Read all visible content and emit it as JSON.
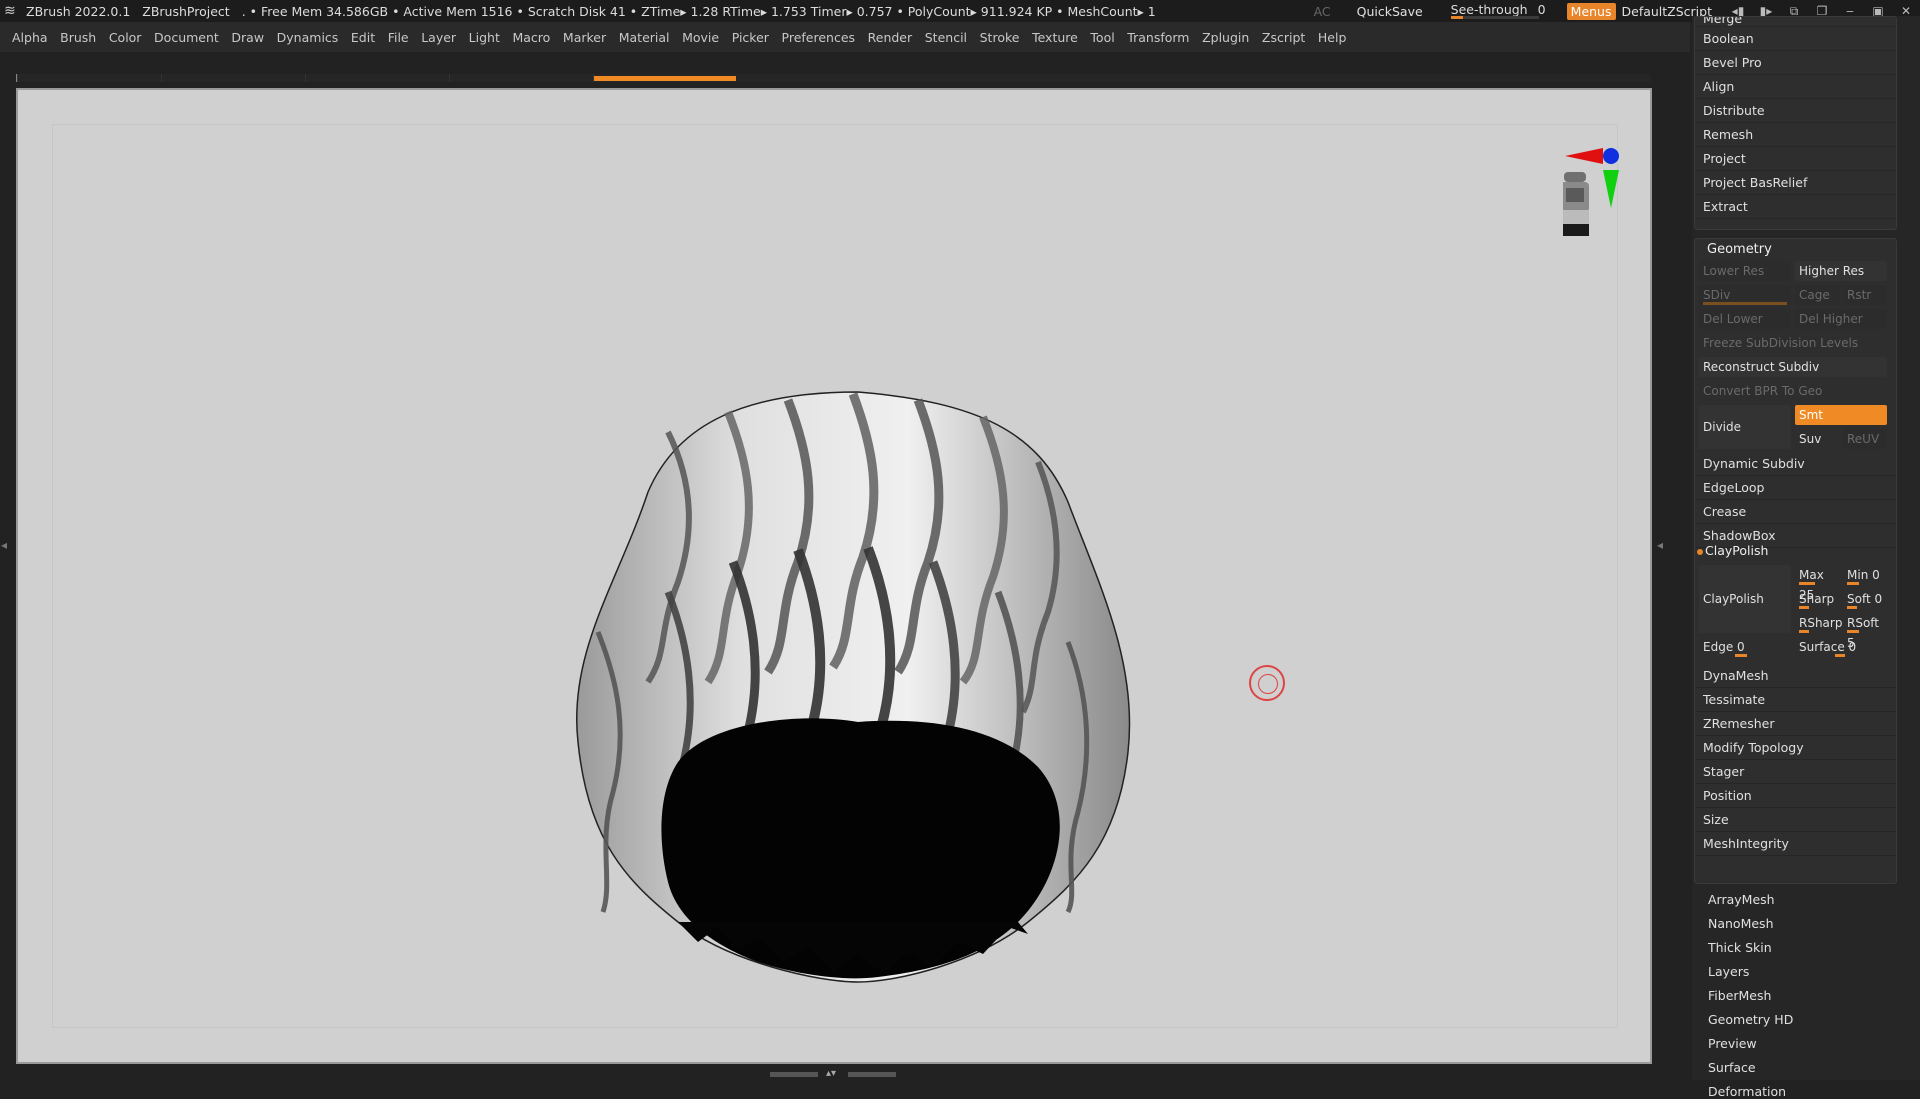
{
  "titlebar": {
    "app": "ZBrush 2022.0.1",
    "project": "ZBrushProject",
    "stats": ". • Free Mem 34.586GB • Active Mem 1516 • Scratch Disk 41 •  ZTime▸ 1.28 RTime▸ 1.753 Timer▸ 0.757 • PolyCount▸ 911.924 KP  • MeshCount▸ 1",
    "ac": "AC",
    "quicksave": "QuickSave",
    "see_through_label": "See-through",
    "see_through_value": "0",
    "see_through_level": 0,
    "menus": "Menus",
    "default_zscript": "DefaultZScript"
  },
  "menu": [
    "Alpha",
    "Brush",
    "Color",
    "Document",
    "Draw",
    "Dynamics",
    "Edit",
    "File",
    "Layer",
    "Light",
    "Macro",
    "Marker",
    "Material",
    "Movie",
    "Picker",
    "Preferences",
    "Render",
    "Stencil",
    "Stroke",
    "Texture",
    "Tool",
    "Transform",
    "Zplugin",
    "Zscript",
    "Help"
  ],
  "panel_top": {
    "items": [
      "Merge",
      "Boolean",
      "Bevel Pro",
      "Align",
      "Distribute",
      "Remesh",
      "Project",
      "Project BasRelief",
      "Extract"
    ]
  },
  "geometry": {
    "title": "Geometry",
    "lower_res": "Lower Res",
    "higher_res": "Higher Res",
    "sdiv": "SDiv",
    "cage": "Cage",
    "rstr": "Rstr",
    "del_lower": "Del Lower",
    "del_higher": "Del Higher",
    "freeze": "Freeze SubDivision Levels",
    "reconstruct": "Reconstruct Subdiv",
    "convert_bpr": "Convert BPR To Geo",
    "divide": "Divide",
    "smt": "Smt",
    "suv": "Suv",
    "reuv": "ReUV",
    "rows_a": [
      "Dynamic Subdiv",
      "EdgeLoop",
      "Crease",
      "ShadowBox"
    ],
    "claypolish_header": "ClayPolish",
    "claypolish_btn": "ClayPolish",
    "max": "Max 25",
    "min": "Min 0",
    "sharp": "Sharp",
    "soft": "Soft 0",
    "rsharp": "RSharp",
    "rsoft": "RSoft 5",
    "edge": "Edge 0",
    "surface": "Surface 0",
    "rows_b": [
      "DynaMesh",
      "Tessimate",
      "ZRemesher",
      "Modify Topology",
      "Stager",
      "Position",
      "Size",
      "MeshIntegrity"
    ]
  },
  "panel_after": [
    "ArrayMesh",
    "NanoMesh",
    "Thick Skin",
    "Layers",
    "FiberMesh",
    "Geometry HD",
    "Preview",
    "Surface",
    "Deformation"
  ],
  "colors": {
    "accent": "#f08a24",
    "bg": "#222222",
    "canvas": "#d0d0d0"
  }
}
